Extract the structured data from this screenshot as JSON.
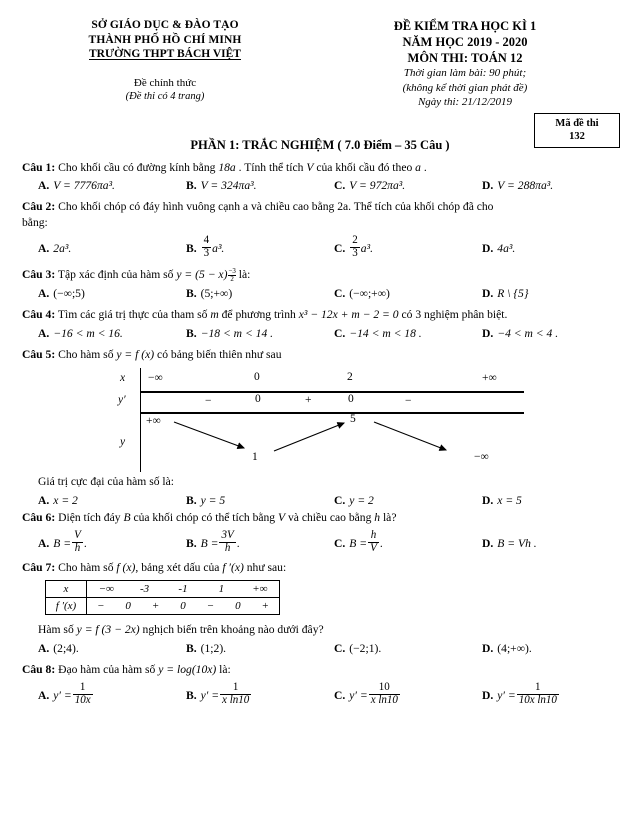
{
  "header": {
    "left": {
      "line1": "SỞ GIÁO DỤC & ĐÀO TẠO",
      "line2": "THÀNH PHỐ HỒ CHÍ MINH",
      "line3": "TRƯỜNG THPT BÁCH  VIỆT",
      "sub1": "Đề chính thức",
      "sub2": "(Đề thi có 4 trang)"
    },
    "right": {
      "line1": "ĐỀ KIỂM TRA HỌC KÌ 1",
      "line2": "NĂM HỌC 2019 - 2020",
      "line3": "MÔN THI: TOÁN 12",
      "line4": "Thời gian làm bài: 90 phút;",
      "line5": "(không kể thời gian phát đề)",
      "line6": "Ngày thi: 21/12/2019"
    },
    "code_box": {
      "label": "Mã đề thi",
      "value": "132"
    }
  },
  "part_title": "PHẦN 1: TRẮC NGHIỆM ( 7.0 Điểm – 35 Câu )",
  "questions": [
    {
      "label": "Câu 1:",
      "text_before": "Cho khối cầu có đường kính bằng ",
      "math1": "18a",
      "text_mid": " . Tính thể tích ",
      "math2": "V",
      "text_mid2": " của khối cầu đó theo ",
      "math3": "a",
      "text_after": " .",
      "options": [
        {
          "letter": "A.",
          "value": "V = 7776πa³."
        },
        {
          "letter": "B.",
          "value": "V = 324πa³."
        },
        {
          "letter": "C.",
          "value": "V = 972πa³."
        },
        {
          "letter": "D.",
          "value": "V = 288πa³."
        }
      ]
    },
    {
      "label": "Câu 2:",
      "text": "Cho khối chóp có đáy hình vuông cạnh a và chiều cao bằng 2a. Thể tích của khối chóp đã cho",
      "text_line2": "bằng:",
      "options": [
        {
          "letter": "A.",
          "value": "2a³."
        },
        {
          "letter": "B.",
          "num": "4",
          "den": "3",
          "suffix": "a³."
        },
        {
          "letter": "C.",
          "num": "2",
          "den": "3",
          "suffix": "a³."
        },
        {
          "letter": "D.",
          "value": "4a³."
        }
      ]
    },
    {
      "label": "Câu 3:",
      "text_before": "Tập xác định của hàm số  ",
      "expr_base": "y = (5 − x)",
      "exp_num": "3",
      "exp_den": "2",
      "exp_sign": "−",
      "text_after": " là:",
      "options": [
        {
          "letter": "A.",
          "value": "(−∞;5)"
        },
        {
          "letter": "B.",
          "value": "(5;+∞)"
        },
        {
          "letter": "C.",
          "value": "(−∞;+∞)"
        },
        {
          "letter": "D.",
          "value": "R \\ {5}"
        }
      ]
    },
    {
      "label": "Câu 4:",
      "text_before": "Tìm các giá trị thực của tham số ",
      "m": "m",
      "text_mid": " để phương trình ",
      "eq": "x³ − 12x + m − 2 = 0",
      "text_after": " có 3 nghiệm phân biệt.",
      "options": [
        {
          "letter": "A.",
          "value": "−16 < m < 16."
        },
        {
          "letter": "B.",
          "value": "−18 < m < 14 ."
        },
        {
          "letter": "C.",
          "value": "−14 < m < 18 ."
        },
        {
          "letter": "D.",
          "value": "−4 < m < 4 ."
        }
      ]
    },
    {
      "label": "Câu 5:",
      "text_before": "Cho hàm số  ",
      "fn": "y = f (x)",
      "text_after": "  có bảng biến thiên như sau",
      "prompt": "Giá trị cực đại của hàm số là:",
      "options": [
        {
          "letter": "A.",
          "value": "x = 2"
        },
        {
          "letter": "B.",
          "value": "y = 5"
        },
        {
          "letter": "C.",
          "value": "y = 2"
        },
        {
          "letter": "D.",
          "value": "x = 5"
        }
      ]
    },
    {
      "label": "Câu 6:",
      "text_before": "Diện tích đáy ",
      "B": "B",
      "text_mid": "  của khối chóp có thể tích bằng  ",
      "V": "V",
      "text_mid2": " và chiều cao bằng ",
      "h": "h",
      "text_after": " là?",
      "options": [
        {
          "letter": "A.",
          "lead": "B =",
          "num": "V",
          "den": "h",
          "suffix": "."
        },
        {
          "letter": "B.",
          "lead": "B =",
          "num": "3V",
          "den": "h",
          "suffix": "."
        },
        {
          "letter": "C.",
          "lead": "B =",
          "num": "h",
          "den": "V",
          "suffix": "."
        },
        {
          "letter": "D.",
          "value": "B = Vh ."
        }
      ]
    },
    {
      "label": "Câu 7:",
      "text_before": "Cho hàm số ",
      "fx": "f (x)",
      "text_mid": ", bảng xét dấu của ",
      "fpx": "f ′(x)",
      "text_after": " như sau:",
      "prompt_before": "Hàm số ",
      "prompt_fn": "y = f (3 − 2x)",
      "prompt_after": " nghịch biến trên khoảng nào dưới đây?",
      "options": [
        {
          "letter": "A.",
          "value": "(2;4)."
        },
        {
          "letter": "B.",
          "value": "(1;2)."
        },
        {
          "letter": "C.",
          "value": "(−2;1)."
        },
        {
          "letter": "D.",
          "value": "(4;+∞)."
        }
      ]
    },
    {
      "label": "Câu 8:",
      "text_before": "Đạo hàm của hàm số  ",
      "fn": "y = log(10x)",
      "text_after": "  là:",
      "options": [
        {
          "letter": "A.",
          "lead": "y′ =",
          "num": "1",
          "den": "10x"
        },
        {
          "letter": "B.",
          "lead": "y′ =",
          "num": "1",
          "den": "x ln10"
        },
        {
          "letter": "C.",
          "lead": "y′ =",
          "num": "10",
          "den": "x ln10"
        },
        {
          "letter": "D.",
          "lead": "y′ =",
          "num": "1",
          "den": "10x ln10"
        }
      ]
    }
  ],
  "variation_table": {
    "row_labels": {
      "x": "x",
      "yp": "y′",
      "y": "y"
    },
    "x_values": [
      "−∞",
      "0",
      "2",
      "+∞"
    ],
    "yp_values": [
      "−",
      "0",
      "+",
      "0",
      "−"
    ],
    "y_values": {
      "start": "+∞",
      "min": "1",
      "max": "5",
      "end": "−∞"
    }
  },
  "sign_table": {
    "row1_label": "x",
    "row1_values": [
      "−∞",
      "-3",
      "-1",
      "1",
      "+∞"
    ],
    "row2_label": "f ′(x)",
    "row2_values": [
      "−",
      "0",
      "+",
      "0",
      "−",
      "0",
      "+"
    ]
  },
  "chart_data": {
    "type": "table",
    "title": "Bảng biến thiên (variation table) — Câu 5",
    "x_breakpoints": [
      "−∞",
      "0",
      "2",
      "+∞"
    ],
    "derivative_signs": [
      "−",
      "0",
      "+",
      "0",
      "−"
    ],
    "function_values": [
      "+∞",
      "1",
      "5",
      "−∞"
    ],
    "monotonicity": [
      "decreasing",
      "increasing",
      "decreasing"
    ],
    "local_max": 5,
    "local_min": 1
  }
}
